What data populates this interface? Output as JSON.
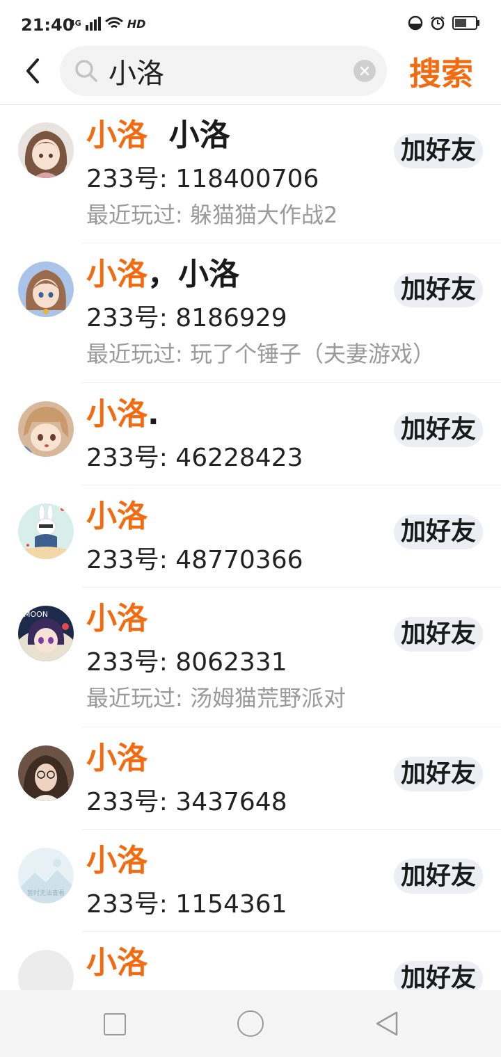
{
  "status": {
    "time": "21:40",
    "network": "4G",
    "hd": "HD"
  },
  "search": {
    "query": "小洛",
    "placeholder": "",
    "button_label": "搜索"
  },
  "colors": {
    "accent": "#f26b10"
  },
  "results": [
    {
      "name_match": "小洛",
      "name_rest": "  小洛",
      "uid": "233号: 118400706",
      "recent": "最近玩过: 躲猫猫大作战2",
      "button": "加好友",
      "avatar": "anime-girl-avatar"
    },
    {
      "name_match": "小洛",
      "name_rest": "，小洛",
      "uid": "233号: 8186929",
      "recent": "最近玩过: 玩了个锤子（夫妻游戏）",
      "button": "加好友",
      "avatar": "anime-girl-avatar"
    },
    {
      "name_match": "小洛",
      "name_rest": ".",
      "uid": "233号: 46228423",
      "recent": "",
      "button": "加好友",
      "avatar": "anime-boy-avatar"
    },
    {
      "name_match": "小洛",
      "name_rest": "",
      "uid": "233号: 48770366",
      "recent": "",
      "button": "加好友",
      "avatar": "bunny-avatar"
    },
    {
      "name_match": "小洛",
      "name_rest": "",
      "uid": "233号: 8062331",
      "recent": "最近玩过: 汤姆猫荒野派对",
      "button": "加好友",
      "avatar": "moon-anime-avatar"
    },
    {
      "name_match": "小洛",
      "name_rest": "",
      "uid": "233号: 3437648",
      "recent": "",
      "button": "加好友",
      "avatar": "photo-avatar"
    },
    {
      "name_match": "小洛",
      "name_rest": "",
      "uid": "233号: 1154361",
      "recent": "",
      "button": "加好友",
      "avatar": "placeholder-image-avatar"
    },
    {
      "name_match": "小洛",
      "name_rest": "",
      "uid": "",
      "recent": "",
      "button": "加好友",
      "avatar": "empty-avatar"
    }
  ],
  "avatar_placeholder_text": "暂时无法查看"
}
